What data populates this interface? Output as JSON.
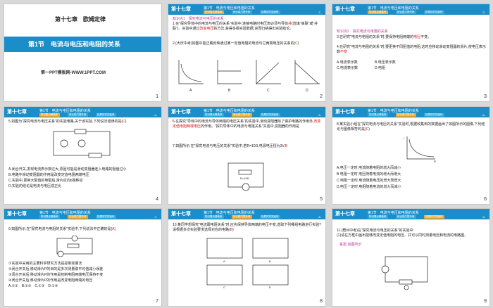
{
  "slides": [
    {
      "num": "1",
      "chapter": "第十七章　欧姆定律",
      "section": "第1节　电流与电压和电阻的关系",
      "site": "第一PPT模板网-WWW.1PPT.COM"
    },
    {
      "num": "2",
      "chapter": "第十七章",
      "section": "第1节　电流与电压和电阻的关系",
      "tabs": [
        "知识要点基础练",
        "综合能力提升练",
        "拓展探究突破练"
      ],
      "page": "-2-",
      "l1": "知识点1　探究电流与电压的关系",
      "l2": "1.在\"探究导体中的电流与电压的关系\"实验中,连接电路时电压表必须与导体",
      "l2b": "并",
      "l2c": "(选填\"串联\"或\"并联\")。实验中通过",
      "l2d": "改变电压",
      "l2e": "的方法,获得多组实验数据,进而归纳得出实验结论。",
      "l3": "2.(大庆中考)如图中能正确反映通过某一定值电阻的电流与它两端电压的关系的(",
      "l3a": "C",
      "l3b": ")",
      "graphs": [
        "A",
        "B",
        "C",
        "D"
      ],
      "axisY": "I",
      "axisX": "U"
    },
    {
      "num": "3",
      "chapter": "第十七章",
      "section": "第1节　电流与电压和电阻的关系",
      "tabs": [
        "知识要点基础练",
        "综合能力提升练",
        "拓展探究突破练"
      ],
      "page": "-3-",
      "l1": "知识点2　探究电流与电阻的关系",
      "l2": "3.在研究\"电流与电阻的关系\"时,要保持电阻两端的",
      "l2a": "电压",
      "l2b": "不变。",
      "l3": "4.在研究\"电流与电阻的关系\"时,要更换不同阻值的电阻,这时应移动滑动变阻器的滑片,使电压表示数",
      "l3a": "不变",
      "l4": "A.电流表示数",
      "l5": "C.电流表示数",
      "l6": "B.电压表示数",
      "l7": "D.电阻"
    },
    {
      "num": "4",
      "chapter": "第十七章",
      "section": "第1节　电流与电压和电阻的关系",
      "tabs": [
        "知识要点基础练",
        "综合能力提升练",
        "拓展探究突破练"
      ],
      "page": "-4-",
      "l1": "5.如图为\"探究电流与电压关系\"的实验电路,关于该实验,下列说法错误的是(",
      "l1a": "C",
      "l1b": ")",
      "opts": [
        "A.闭合开关,发现电流表示数过大,原因可能是滑动变阻器连入电路的阻值过小",
        "B.电路中滑动变阻器的作用是改变定值电阻两端电压",
        "C.实验中,更换大阻值的电阻后,滑片应向b端移动",
        "D.实验的结论是电流与电压成正比"
      ]
    },
    {
      "num": "5",
      "chapter": "第十七章",
      "section": "第1节　电流与电压和电阻的关系",
      "tabs": [
        "知识要点基础练",
        "综合能力提升练",
        "拓展探究突破练"
      ],
      "page": "-5-",
      "l1": "6.在探究\"导体中的电流与导体两端的电压关系\"的实验中,滑动变阻器除了保护电路的作用外,",
      "l1a": "改变定值电阻两端电压",
      "l1b": "的作用。\"探究导体中的电流与电阻关系\"实验中,变阻器的作用是",
      "l2": "7.如图所示,在\"探究电流与电压的关系\"实验中,若R=10Ω,电源电压恒为3V,",
      "l2a": "B",
      "resistor": "R=10Ω"
    },
    {
      "num": "6",
      "chapter": "第十七章",
      "section": "第1节　电流与电压和电阻的关系",
      "tabs": [
        "知识要点基础练",
        "综合能力提升练",
        "拓展探究突破练"
      ],
      "page": "-6-",
      "l1": "8.某实验小组在\"探究电流与电压的关系\"实验时,根据收集到的数据画出了如图所示的图像,下列结论与图像相符的是(",
      "l1a": "C",
      "l1b": ")",
      "opts": [
        "A.电压一定时,电流随着电阻的增大而减小",
        "B.电阻一定时,电压随着电流的增大而增大",
        "C.电阻一定时,电流随着电压的增大而增大",
        "D.电压一定时,电阻随着电流的增大而减小"
      ],
      "axisY": "I",
      "axisX": "R"
    },
    {
      "num": "7",
      "chapter": "第十七章",
      "section": "第1节　电流与电压和电阻的关系",
      "tabs": [
        "知识要点基础练",
        "综合能力提升练",
        "拓展探究突破练"
      ],
      "page": "-7-",
      "l1": "9.如图所示,在\"探究电流与电阻的关系\"实验中,下列说法中正确的是(",
      "l1a": "A",
      "l1b": ")",
      "opts": [
        "①实验中采用的主要科学研究方法是控制变量法",
        "②闭合开关后,移动滑片P的目的是多次测量取平均值减小误差",
        "③闭合开关后,移动滑片P的作用是控制电阻两端电压保持不变",
        "④闭合开关后,移动滑片P的作用是改变电阻两端的电压",
        "A.①②　B.②③　C.①③　D.①④"
      ]
    },
    {
      "num": "8",
      "chapter": "第十七章",
      "section": "第1节　电流与电压和电阻的关系",
      "tabs": [
        "知识要点基础练",
        "综合能力提升练",
        "拓展探究突破练"
      ],
      "page": "-8-",
      "l1": "10.某同学想探究\"电流跟电阻关系\"时,应先保持导体两端的电压不变,选取下列哪组电路进行实验?请根据多次实验要求选择对应的电路(",
      "l1a": "B",
      "l1b": ")",
      "opts": [
        "A",
        "B",
        "C",
        "D"
      ]
    },
    {
      "num": "9",
      "chapter": "第十七章",
      "section": "第1节　电流与电压和电阻的关系",
      "tabs": [
        "知识要点基础练",
        "综合能力提升练",
        "拓展探究突破练"
      ],
      "page": "-9-",
      "l1": "11.(梧州中考)在\"探究电流与电压的关系\"的实验中:",
      "l2": "(1)请在方框中画出能够改变定值电阻的电压、并可以同时测量电压和电流的电路图。",
      "l3": "答案:如图所示"
    }
  ],
  "colors": {
    "header": "#1b8ec9",
    "tab": "#2da7e0",
    "tab_active": "#f5a623",
    "answer_red": "#d11",
    "title_blue": "#1a6fc4"
  }
}
